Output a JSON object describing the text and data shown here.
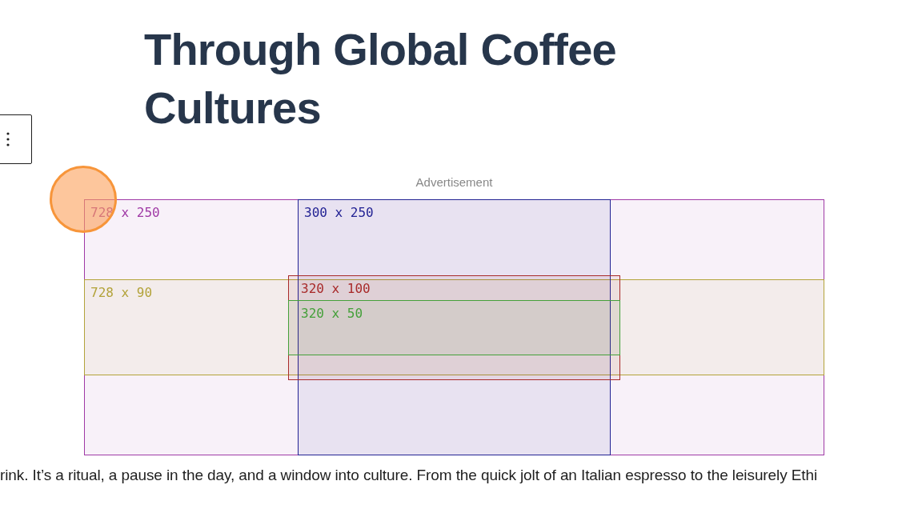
{
  "title": "Through Global Coffee Cultures",
  "ad_preview": {
    "label": "Advertisement",
    "sizes": [
      {
        "label": "728 x 250",
        "color": "#a03aa6"
      },
      {
        "label": "728 x 90",
        "color": "#b3a33a"
      },
      {
        "label": "300 x 250",
        "color": "#232394"
      },
      {
        "label": "320 x 100",
        "color": "#a82a2a"
      },
      {
        "label": "320 x 50",
        "color": "#45a03a"
      }
    ]
  },
  "paragraph": "rink. It’s a ritual, a pause in the day, and a window into culture. From the quick jolt of an Italian espresso to the leisurely Ethi"
}
